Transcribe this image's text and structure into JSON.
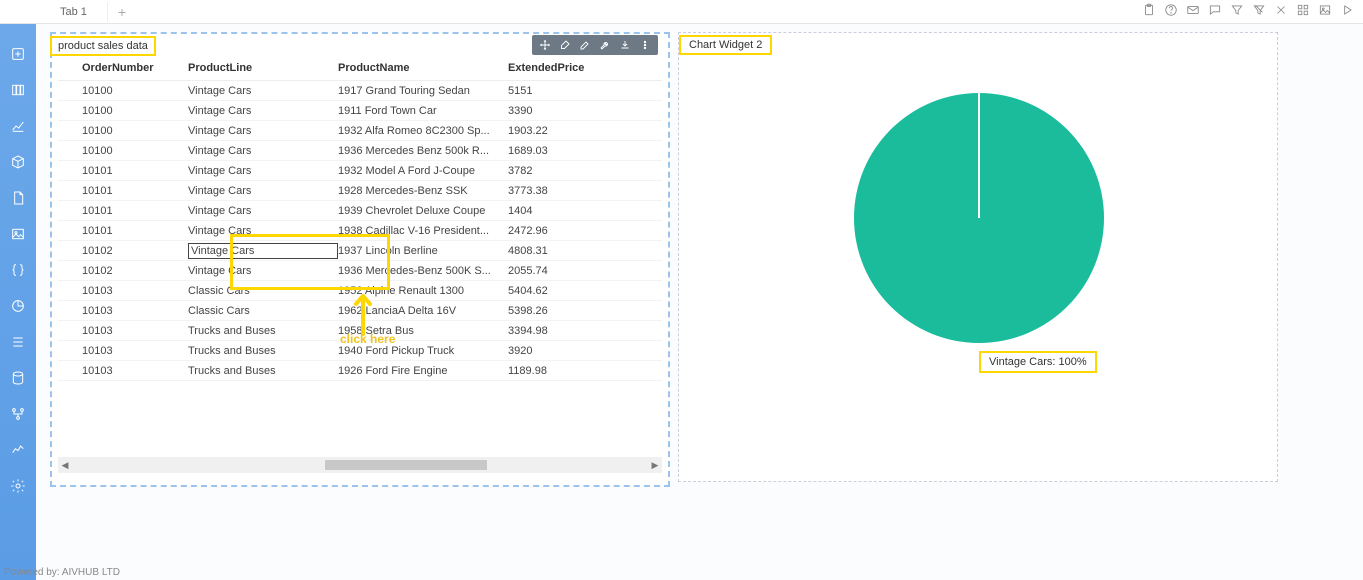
{
  "tabs": {
    "tab1": "Tab 1"
  },
  "footer": "Powered by: AIVHUB LTD",
  "annotation": {
    "click_here": "click here"
  },
  "table_widget": {
    "title": "product sales data",
    "columns": [
      "OrderNumber",
      "ProductLine",
      "ProductName",
      "ExtendedPrice"
    ],
    "rows": [
      {
        "order": "10100",
        "line": "Vintage Cars",
        "name": "1917 Grand Touring Sedan",
        "price": "5151"
      },
      {
        "order": "10100",
        "line": "Vintage Cars",
        "name": "1911 Ford Town Car",
        "price": "3390"
      },
      {
        "order": "10100",
        "line": "Vintage Cars",
        "name": "1932 Alfa Romeo 8C2300 Sp...",
        "price": "1903.22"
      },
      {
        "order": "10100",
        "line": "Vintage Cars",
        "name": "1936 Mercedes Benz 500k R...",
        "price": "1689.03"
      },
      {
        "order": "10101",
        "line": "Vintage Cars",
        "name": "1932 Model A Ford J-Coupe",
        "price": "3782"
      },
      {
        "order": "10101",
        "line": "Vintage Cars",
        "name": "1928 Mercedes-Benz SSK",
        "price": "3773.38"
      },
      {
        "order": "10101",
        "line": "Vintage Cars",
        "name": "1939 Chevrolet Deluxe Coupe",
        "price": "1404"
      },
      {
        "order": "10101",
        "line": "Vintage Cars",
        "name": "1938 Cadillac V-16 President...",
        "price": "2472.96"
      },
      {
        "order": "10102",
        "line": "Vintage Cars",
        "name": "1937 Lincoln Berline",
        "price": "4808.31",
        "selected": true
      },
      {
        "order": "10102",
        "line": "Vintage Cars",
        "name": "1936 Mercedes-Benz 500K S...",
        "price": "2055.74"
      },
      {
        "order": "10103",
        "line": "Classic Cars",
        "name": "1952 Alpine Renault 1300",
        "price": "5404.62"
      },
      {
        "order": "10103",
        "line": "Classic Cars",
        "name": "1962 LanciaA Delta 16V",
        "price": "5398.26"
      },
      {
        "order": "10103",
        "line": "Trucks and Buses",
        "name": "1958 Setra Bus",
        "price": "3394.98"
      },
      {
        "order": "10103",
        "line": "Trucks and Buses",
        "name": "1940 Ford Pickup Truck",
        "price": "3920"
      },
      {
        "order": "10103",
        "line": "Trucks and Buses",
        "name": "1926 Ford Fire Engine",
        "price": "1189.98"
      }
    ]
  },
  "chart_widget": {
    "title": "Chart Widget 2",
    "label": "Vintage Cars: 100%"
  },
  "chart_data": {
    "type": "pie",
    "title": "Chart Widget 2",
    "series": [
      {
        "name": "Vintage Cars",
        "value": 100
      }
    ],
    "colors": {
      "Vintage Cars": "#1abc9c"
    }
  }
}
